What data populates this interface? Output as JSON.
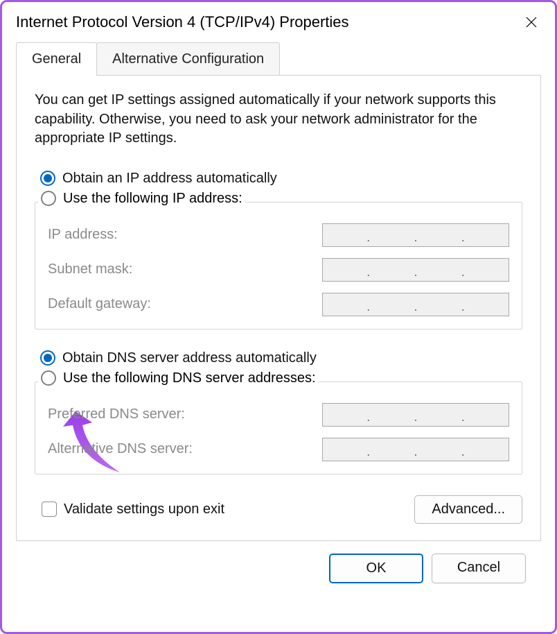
{
  "window": {
    "title": "Internet Protocol Version 4 (TCP/IPv4) Properties"
  },
  "tabs": {
    "general": "General",
    "alternative": "Alternative Configuration"
  },
  "intro": "You can get IP settings assigned automatically if your network supports this capability. Otherwise, you need to ask your network administrator for the appropriate IP settings.",
  "ip": {
    "obtain_auto": "Obtain an IP address automatically",
    "use_following": "Use the following IP address:",
    "address_label": "IP address:",
    "subnet_label": "Subnet mask:",
    "gateway_label": "Default gateway:",
    "address_value": "",
    "subnet_value": "",
    "gateway_value": ""
  },
  "dns": {
    "obtain_auto": "Obtain DNS server address automatically",
    "use_following": "Use the following DNS server addresses:",
    "preferred_label": "Preferred DNS server:",
    "alternative_label": "Alternative DNS server:",
    "preferred_value": "",
    "alternative_value": ""
  },
  "validate_label": "Validate settings upon exit",
  "buttons": {
    "advanced": "Advanced...",
    "ok": "OK",
    "cancel": "Cancel"
  },
  "state": {
    "ip_mode": "auto",
    "dns_mode": "auto",
    "validate_checked": false,
    "active_tab": "general"
  }
}
